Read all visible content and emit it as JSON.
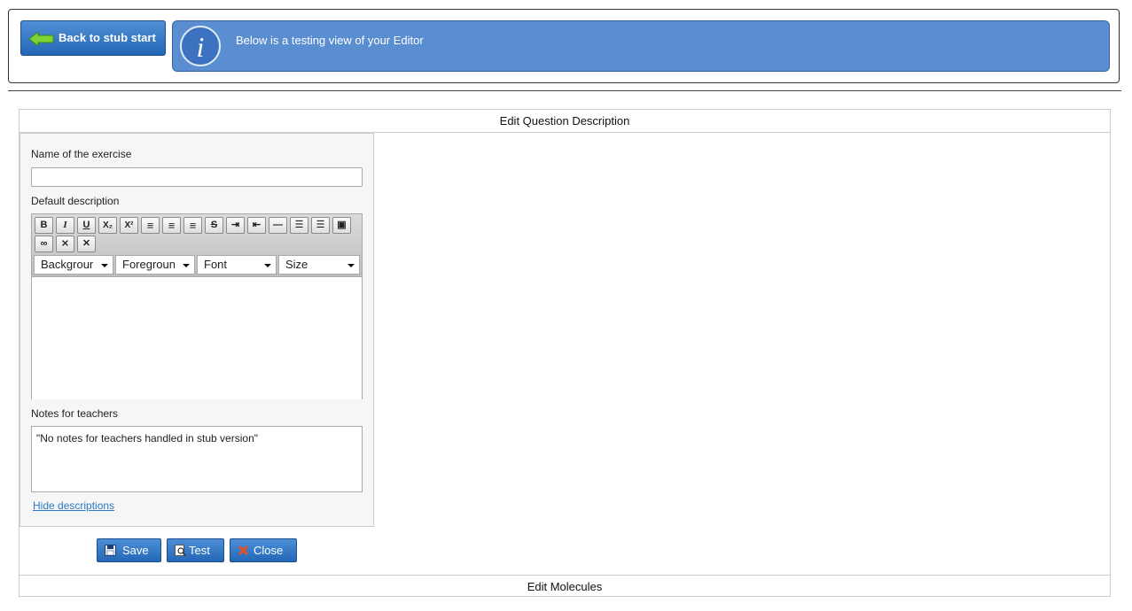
{
  "header": {
    "back_label": "Back to stub start",
    "info_text": "Below is a testing view of your Editor"
  },
  "panel": {
    "title": "Edit Question Description",
    "footer_title": "Edit Molecules"
  },
  "form": {
    "name_label": "Name of the exercise",
    "name_value": "",
    "desc_label": "Default description",
    "notes_label": "Notes for teachers",
    "notes_value": "\"No notes for teachers handled in stub version\"",
    "hide_link": "Hide descriptions"
  },
  "toolbar": {
    "buttons": [
      {
        "icon": "bold-icon",
        "glyph": "B"
      },
      {
        "icon": "italic-icon",
        "glyph": "I"
      },
      {
        "icon": "underline-icon",
        "glyph": "U"
      },
      {
        "icon": "subscript-icon",
        "glyph": "X₂"
      },
      {
        "icon": "superscript-icon",
        "glyph": "X²"
      },
      {
        "icon": "align-left-icon",
        "glyph": "≡"
      },
      {
        "icon": "align-center-icon",
        "glyph": "≡"
      },
      {
        "icon": "align-right-icon",
        "glyph": "≡"
      },
      {
        "icon": "strikethrough-icon",
        "glyph": "S"
      },
      {
        "icon": "indent-icon",
        "glyph": "⇥"
      },
      {
        "icon": "outdent-icon",
        "glyph": "⇤"
      },
      {
        "icon": "horizontal-rule-icon",
        "glyph": "—"
      },
      {
        "icon": "ordered-list-icon",
        "glyph": "☰"
      },
      {
        "icon": "unordered-list-icon",
        "glyph": "☰"
      },
      {
        "icon": "image-icon",
        "glyph": "▣"
      },
      {
        "icon": "link-icon",
        "glyph": "∞"
      },
      {
        "icon": "unlink-icon",
        "glyph": "⨯"
      },
      {
        "icon": "remove-format-icon",
        "glyph": "✕"
      }
    ],
    "selects": [
      "Background",
      "Foreground",
      "Font",
      "Size"
    ]
  },
  "buttons": {
    "save": "Save",
    "test": "Test",
    "close": "Close"
  },
  "colors": {
    "accent": "#2467b6",
    "info_bg": "#5b8dd1",
    "link": "#2b79c2"
  }
}
